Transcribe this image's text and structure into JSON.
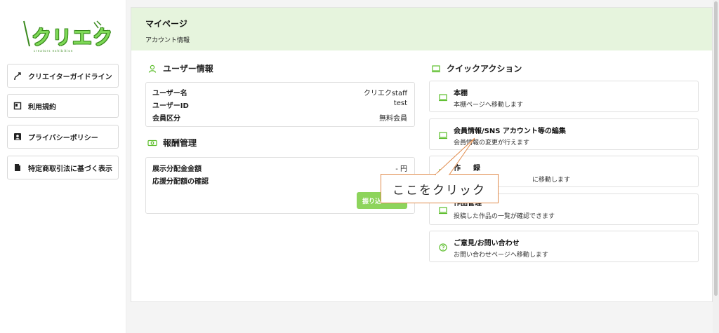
{
  "logo": {
    "text": "クリエク",
    "subtitle": "creators exhibition"
  },
  "sidebar": {
    "items": [
      {
        "label": "クリエイターガイドライン",
        "icon": "guideline-icon"
      },
      {
        "label": "利用規約",
        "icon": "book-icon"
      },
      {
        "label": "プライバシーポリシー",
        "icon": "privacy-icon"
      },
      {
        "label": "特定商取引法に基づく表示",
        "icon": "document-icon"
      }
    ]
  },
  "header": {
    "title": "マイページ",
    "subtitle": "アカウント情報"
  },
  "user_info": {
    "title": "ユーザー情報",
    "rows": [
      {
        "key": "ユーザー名",
        "value": "クリエクstaff"
      },
      {
        "key": "ユーザーID",
        "value": "test"
      },
      {
        "key": "会員区分",
        "value": "無料会員"
      }
    ]
  },
  "reward": {
    "title": "報酬管理",
    "rows": [
      {
        "key": "展示分配金金額",
        "value": "- 円"
      },
      {
        "key": "応援分配額の確認",
        "value": ""
      }
    ],
    "button_label": "振り込"
  },
  "quick_actions": {
    "title": "クイックアクション",
    "items": [
      {
        "title": "本棚",
        "desc": "本棚ページへ移動します"
      },
      {
        "title": "会員情報/SNS アカウント等の編集",
        "desc": "会員情報の変更が行えます"
      },
      {
        "title": "作",
        "desc": "に移動します",
        "title_tail": "録"
      },
      {
        "title": "作品管理",
        "desc": "投稿した作品の一覧が確認できます"
      },
      {
        "title": "ご意見/お問い合わせ",
        "desc": "お問い合わせページへ移動します"
      }
    ]
  },
  "callout": {
    "text": "ここをクリック"
  },
  "colors": {
    "accent": "#8dd45c",
    "header_bg": "#e6f4dd",
    "callout_border": "#e08a4a",
    "icon_green": "#5bbd2a"
  }
}
